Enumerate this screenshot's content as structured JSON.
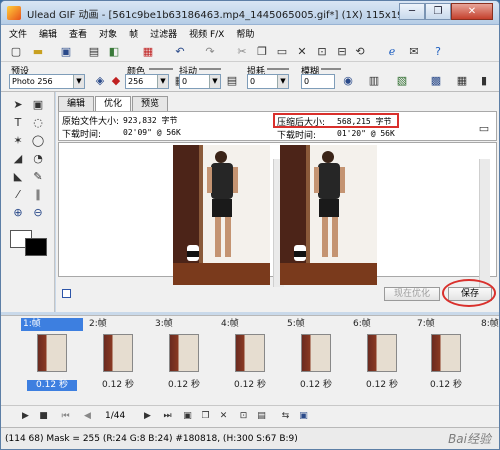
{
  "window": {
    "title": "Ulead GIF 动画 - [561c9be1b63186463.mp4_1445065005.gif*] (1X) 115x199",
    "controls": {
      "minimize": "─",
      "restore": "❐",
      "close": "✕"
    }
  },
  "menu": [
    "文件",
    "编辑",
    "查看",
    "对象",
    "帧",
    "过滤器",
    "视频 F/X",
    "帮助"
  ],
  "toolbar": {
    "icons": [
      "new-icon",
      "open-icon",
      "save-icon",
      "print-icon",
      "import-icon",
      "undo-icon",
      "redo-icon",
      "cut-icon",
      "copy-icon",
      "paste-icon",
      "delete-icon",
      "resize-icon",
      "crop-icon",
      "rotate-icon",
      "browser-preview-icon",
      "email-icon",
      "help-icon"
    ]
  },
  "options": {
    "preset_label": "预设",
    "preset_value": "Photo 256",
    "color_label": "颜色",
    "color_value": "256",
    "dither_label": "抖动",
    "dither_value": "0",
    "loss_label": "损耗",
    "loss_value": "0",
    "blur_label": "模糊",
    "blur_value": "0"
  },
  "tabs": [
    {
      "label": "编辑",
      "active": false
    },
    {
      "label": "优化",
      "active": true
    },
    {
      "label": "预览",
      "active": false
    }
  ],
  "info": {
    "original_size_label": "原始文件大小:",
    "original_size_value": "923,832 字节",
    "original_time_label": "下载时间:",
    "original_time_value": "02'09\" @ 56K",
    "compressed_size_label": "压缩后大小:",
    "compressed_size_value": "568,215 字节",
    "compressed_time_label": "下载时间:",
    "compressed_time_value": "01'20\" @ 56K"
  },
  "buttons": {
    "optimize_now": "现在优化",
    "save": "保存"
  },
  "frames": [
    {
      "label": "1:帧",
      "delay": "0.12 秒",
      "selected": true
    },
    {
      "label": "2:帧",
      "delay": "0.12 秒",
      "selected": false
    },
    {
      "label": "3:帧",
      "delay": "0.12 秒",
      "selected": false
    },
    {
      "label": "4:帧",
      "delay": "0.12 秒",
      "selected": false
    },
    {
      "label": "5:帧",
      "delay": "0.12 秒",
      "selected": false
    },
    {
      "label": "6:帧",
      "delay": "0.12 秒",
      "selected": false
    },
    {
      "label": "7:帧",
      "delay": "0.12 秒",
      "selected": false
    },
    {
      "label": "8:帧",
      "delay": "",
      "selected": false
    }
  ],
  "playback": {
    "frame_counter": "1/44"
  },
  "status": {
    "text": "(114 68) Mask = 255 (R:24 G:8 B:24) #180818, (H:300 S:67 B:9)",
    "watermark": "Bai经验"
  },
  "colors": {
    "highlight_red": "#d9302c",
    "selection_blue": "#3d7fe0"
  }
}
